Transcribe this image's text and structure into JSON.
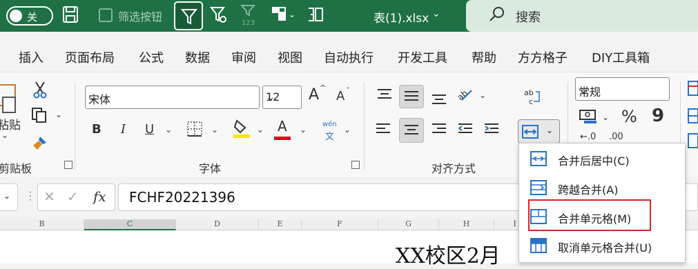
{
  "titlebar": {
    "toggle_label": "关",
    "checkbox_label": "筛选按钮",
    "filename": "表(1).xlsx",
    "search_placeholder": "搜索",
    "colors": {
      "bar": "#1f7145",
      "search_bg": "#dbeadf"
    },
    "icons": [
      "save-icon",
      "filter-icon",
      "filter-settings-icon",
      "number-format-icon",
      "grid-toolbar-icon",
      "calc-icon",
      "chevron-down-icon",
      "search-icon"
    ]
  },
  "menu": {
    "items": [
      "插入",
      "页面布局",
      "公式",
      "数据",
      "审阅",
      "视图",
      "自动执行",
      "开发工具",
      "帮助",
      "方方格子",
      "DIY工具箱"
    ]
  },
  "ribbon": {
    "clipboard": {
      "paste_label": "粘贴",
      "group_label": "剪贴板"
    },
    "font": {
      "font_name": "宋体",
      "font_size": "12",
      "bold": "B",
      "italic": "I",
      "underline": "U",
      "font_color_letter": "A",
      "phonetic_top": "wén",
      "phonetic_bottom": "文",
      "grow": "A",
      "shrink": "A",
      "group_label": "字体",
      "colors": {
        "highlight": "#ffe600",
        "font_color": "#e0001b"
      }
    },
    "alignment": {
      "group_label": "对齐方式",
      "wrap_label": "ab c"
    },
    "number": {
      "format": "常规",
      "percent": "%",
      "comma": "9",
      "dec_inc": "←.0",
      "dec_dec": ".00"
    }
  },
  "formula_bar": {
    "fx": "fx",
    "value": "FCHF20221396"
  },
  "columns": [
    {
      "label": "B",
      "selected": false
    },
    {
      "label": "C",
      "selected": true
    },
    {
      "label": "D",
      "selected": false
    },
    {
      "label": "E",
      "selected": false
    },
    {
      "label": "F",
      "selected": false
    },
    {
      "label": "G",
      "selected": false
    },
    {
      "label": "H",
      "selected": false
    },
    {
      "label": "I",
      "selected": false
    }
  ],
  "sheet": {
    "title_partial": "XX校区2月"
  },
  "merge_menu": {
    "items": [
      {
        "label": "合并后居中(C)",
        "icon": "merge-center-icon"
      },
      {
        "label": "跨越合并(A)",
        "icon": "merge-across-icon"
      },
      {
        "label": "合并单元格(M)",
        "icon": "merge-cells-icon",
        "highlighted": true
      },
      {
        "label": "取消单元格合并(U)",
        "icon": "unmerge-cells-icon"
      }
    ],
    "highlight_color": "#d9232c"
  }
}
